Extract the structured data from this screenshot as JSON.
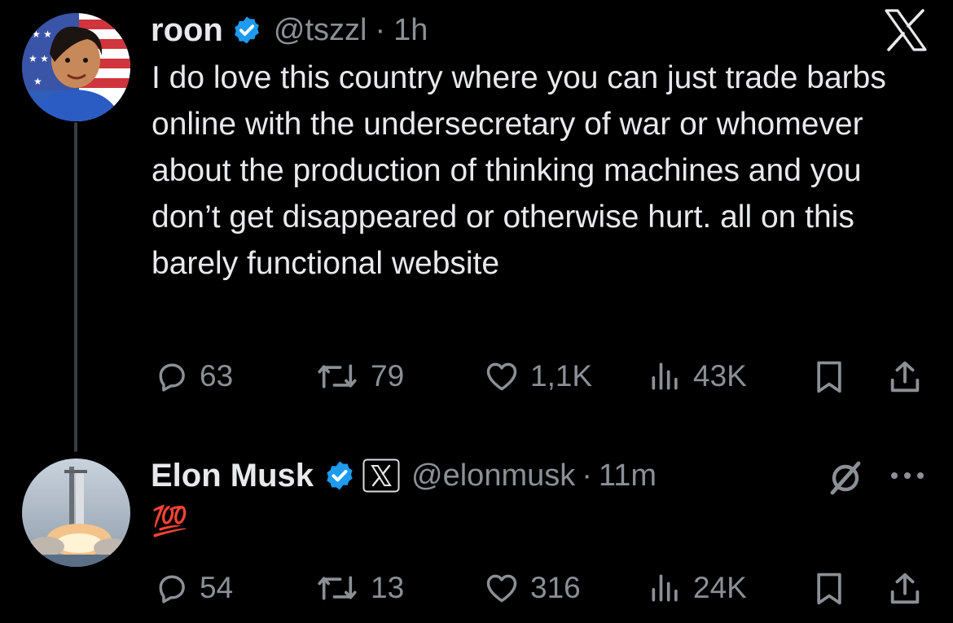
{
  "tweets": [
    {
      "author_name": "roon",
      "handle": "@tszzl",
      "separator": "·",
      "time": "1h",
      "text": "I do love this country where you can just trade barbs online with the undersecretary of war or whomever about the production of thinking machines and you don’t get disappeared or otherwise hurt. all on this barely functional website",
      "stats": {
        "replies": "63",
        "reposts": "79",
        "likes": "1,1K",
        "views": "43K"
      }
    },
    {
      "author_name": "Elon Musk",
      "handle": "@elonmusk",
      "separator": "·",
      "time": "11m",
      "text": "💯",
      "stats": {
        "replies": "54",
        "reposts": "13",
        "likes": "316",
        "views": "24K"
      }
    }
  ],
  "colors": {
    "background": "#000000",
    "text": "#e7e9ea",
    "muted": "#8b9096",
    "verified": "#1d9bf0"
  },
  "icons": [
    "x-logo-icon",
    "verified-badge-icon",
    "reply-icon",
    "repost-icon",
    "like-icon",
    "views-icon",
    "bookmark-icon",
    "share-icon",
    "grok-icon",
    "more-icon"
  ]
}
